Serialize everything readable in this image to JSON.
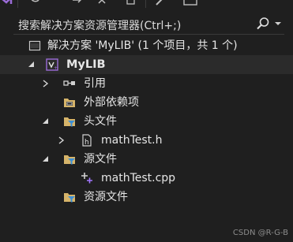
{
  "search": {
    "placeholder": "搜索解决方案资源管理器(Ctrl+;)"
  },
  "tree": {
    "solution_label": "解决方案 'MyLIB' (1 个项目，共 1 个)",
    "project_label": "MyLIB",
    "items": [
      {
        "label": "引用"
      },
      {
        "label": "外部依赖项"
      },
      {
        "label": "头文件"
      },
      {
        "label": "mathTest.h"
      },
      {
        "label": "源文件"
      },
      {
        "label": "mathTest.cpp"
      },
      {
        "label": "资源文件"
      }
    ]
  },
  "watermark": "CSDN @R-G-B",
  "colors": {
    "background": "#1f1f1f",
    "selected_row": "#2b2b2b",
    "filter_icon": "#3c8fd6",
    "folder": "#d6b46a",
    "cpp_plus": "#a277ff",
    "project_icon": "#9b6cd8"
  },
  "icons": {
    "solution": "solution-icon",
    "project": "vc-project-icon",
    "references": "references-icon",
    "external": "external-deps-folder-icon",
    "filter_folder": "filter-folder-icon",
    "header_file": "header-file-icon",
    "cpp_file": "cpp-file-icon"
  }
}
